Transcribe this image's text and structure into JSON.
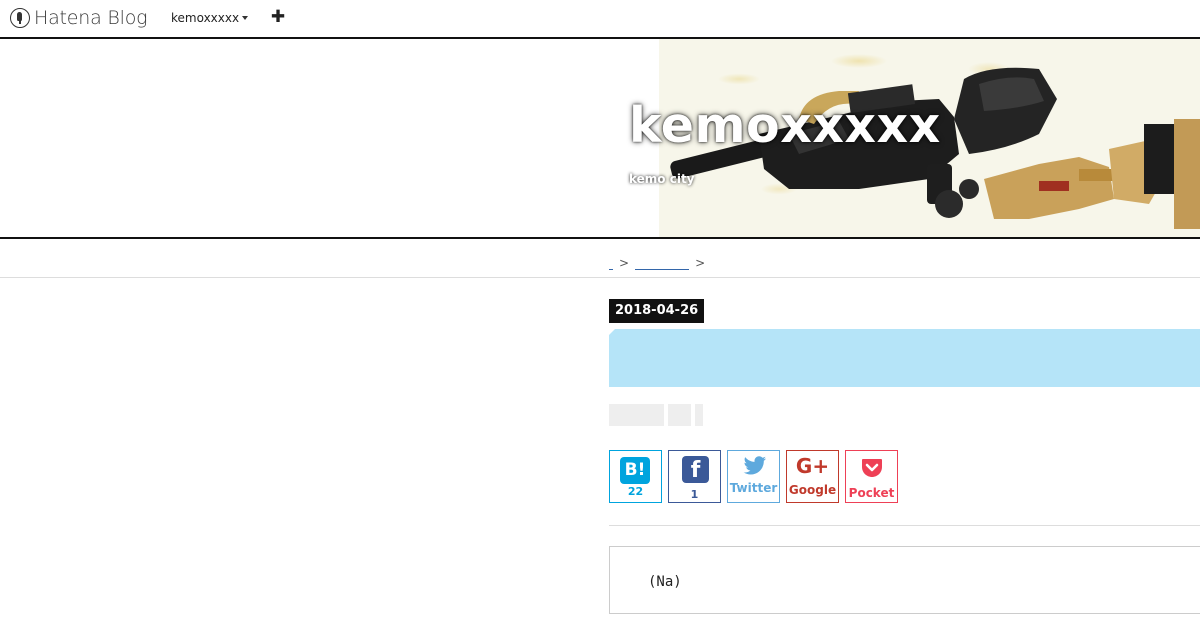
{
  "topnav": {
    "logo_text": "Hatena Blog",
    "user_label": "kemoxxxxx",
    "plus_label": "✚"
  },
  "header": {
    "title": "kemoxxxxx",
    "description": "kemo city"
  },
  "breadcrumb": {
    "separator": ">"
  },
  "entry": {
    "date": "2018-04-26",
    "body_text": "(Na)"
  },
  "share": {
    "hatena": {
      "icon": "B!",
      "count": "22",
      "color": "#00a4de"
    },
    "facebook": {
      "icon": "f",
      "count": "1",
      "color": "#3b5998"
    },
    "twitter": {
      "label": "Twitter",
      "color": "#5ea9dd"
    },
    "google": {
      "icon": "G+",
      "label": "Google",
      "color": "#c0392b"
    },
    "pocket": {
      "label": "Pocket",
      "color": "#ee4056"
    }
  },
  "colors": {
    "title_bar": "#b5e4f8",
    "date_badge": "#111111"
  }
}
